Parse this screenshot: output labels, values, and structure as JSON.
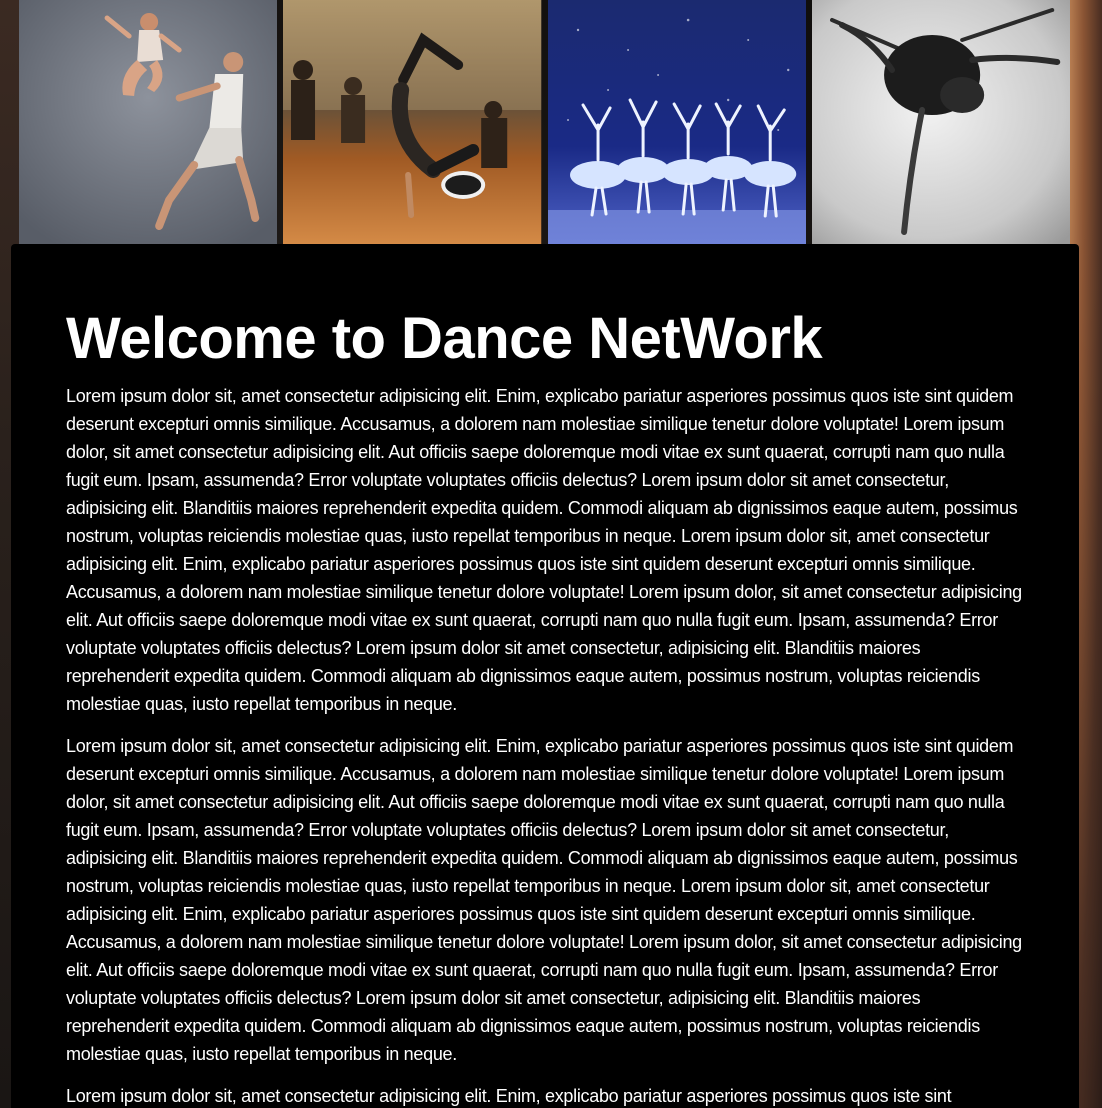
{
  "page": {
    "title": "Welcome to Dance NetWork"
  },
  "banner": {
    "images": [
      {
        "name": "contemporary-duet-photo"
      },
      {
        "name": "breakdance-photo"
      },
      {
        "name": "ballet-ensemble-photo"
      },
      {
        "name": "solo-dancer-photo"
      }
    ]
  },
  "content": {
    "paragraphs": [
      "Lorem ipsum dolor sit, amet consectetur adipisicing elit. Enim, explicabo pariatur asperiores possimus quos iste sint quidem deserunt excepturi omnis similique. Accusamus, a dolorem nam molestiae similique tenetur dolore voluptate! Lorem ipsum dolor, sit amet consectetur adipisicing elit. Aut officiis saepe doloremque modi vitae ex sunt quaerat, corrupti nam quo nulla fugit eum. Ipsam, assumenda? Error voluptate voluptates officiis delectus? Lorem ipsum dolor sit amet consectetur, adipisicing elit. Blanditiis maiores reprehenderit expedita quidem. Commodi aliquam ab dignissimos eaque autem, possimus nostrum, voluptas reiciendis molestiae quas, iusto repellat temporibus in neque. Lorem ipsum dolor sit, amet consectetur adipisicing elit. Enim, explicabo pariatur asperiores possimus quos iste sint quidem deserunt excepturi omnis similique. Accusamus, a dolorem nam molestiae similique tenetur dolore voluptate! Lorem ipsum dolor, sit amet consectetur adipisicing elit. Aut officiis saepe doloremque modi vitae ex sunt quaerat, corrupti nam quo nulla fugit eum. Ipsam, assumenda? Error voluptate voluptates officiis delectus? Lorem ipsum dolor sit amet consectetur, adipisicing elit. Blanditiis maiores reprehenderit expedita quidem. Commodi aliquam ab dignissimos eaque autem, possimus nostrum, voluptas reiciendis molestiae quas, iusto repellat temporibus in neque.",
      "Lorem ipsum dolor sit, amet consectetur adipisicing elit. Enim, explicabo pariatur asperiores possimus quos iste sint quidem deserunt excepturi omnis similique. Accusamus, a dolorem nam molestiae similique tenetur dolore voluptate! Lorem ipsum dolor, sit amet consectetur adipisicing elit. Aut officiis saepe doloremque modi vitae ex sunt quaerat, corrupti nam quo nulla fugit eum. Ipsam, assumenda? Error voluptate voluptates officiis delectus? Lorem ipsum dolor sit amet consectetur, adipisicing elit. Blanditiis maiores reprehenderit expedita quidem. Commodi aliquam ab dignissimos eaque autem, possimus nostrum, voluptas reiciendis molestiae quas, iusto repellat temporibus in neque. Lorem ipsum dolor sit, amet consectetur adipisicing elit. Enim, explicabo pariatur asperiores possimus quos iste sint quidem deserunt excepturi omnis similique. Accusamus, a dolorem nam molestiae similique tenetur dolore voluptate! Lorem ipsum dolor, sit amet consectetur adipisicing elit. Aut officiis saepe doloremque modi vitae ex sunt quaerat, corrupti nam quo nulla fugit eum. Ipsam, assumenda? Error voluptate voluptates officiis delectus? Lorem ipsum dolor sit amet consectetur, adipisicing elit. Blanditiis maiores reprehenderit expedita quidem. Commodi aliquam ab dignissimos eaque autem, possimus nostrum, voluptas reiciendis molestiae quas, iusto repellat temporibus in neque.",
      "Lorem ipsum dolor sit, amet consectetur adipisicing elit. Enim, explicabo pariatur asperiores possimus quos iste sint"
    ]
  },
  "colors": {
    "content_bg": "#000000",
    "text": "#ffffff"
  }
}
